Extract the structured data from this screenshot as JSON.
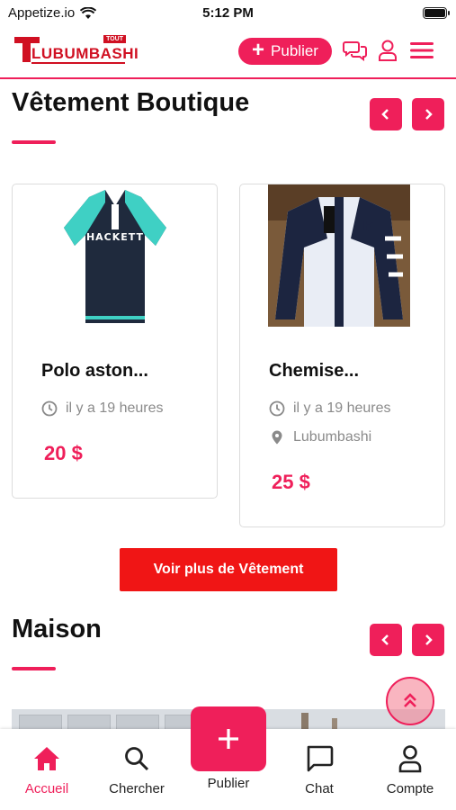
{
  "status_bar": {
    "carrier": "Appetize.io",
    "time": "5:12 PM"
  },
  "header": {
    "logo_tout": "TOUT",
    "logo_word": "LUBUMBASHI",
    "publish_label": "Publier"
  },
  "sections": {
    "vetement": {
      "title": "Vêtement Boutique",
      "cards": [
        {
          "name": "Polo aston...",
          "time": "il y a 19 heures",
          "price": "20 $",
          "image": "polo-shirt-image"
        },
        {
          "name": "Chemise...",
          "time": "il y a 19 heures",
          "location": "Lubumbashi",
          "price": "25 $",
          "image": "shirt-image"
        }
      ],
      "more_label": "Voir plus de Vêtement"
    },
    "maison": {
      "title": "Maison"
    }
  },
  "bottom_nav": [
    {
      "label": "Accueil",
      "icon": "home-icon",
      "active": true
    },
    {
      "label": "Chercher",
      "icon": "search-icon"
    },
    {
      "label": "Publier",
      "icon": "plus-icon"
    },
    {
      "label": "Chat",
      "icon": "chat-icon"
    },
    {
      "label": "Compte",
      "icon": "user-icon"
    }
  ],
  "colors": {
    "accent": "#ef1f5a",
    "button_red": "#f01515",
    "logo_red": "#d01022"
  }
}
